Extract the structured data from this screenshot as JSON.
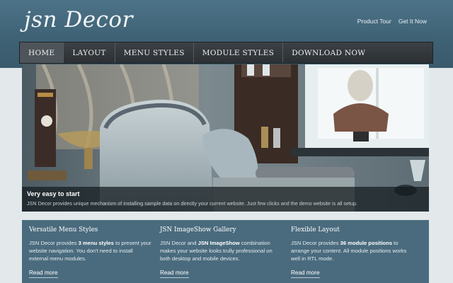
{
  "header": {
    "logo": "jsn Decor",
    "links": [
      "Product Tour",
      "Get It Now"
    ]
  },
  "nav": {
    "items": [
      "HOME",
      "LAYOUT",
      "MENU STYLES",
      "MODULE STYLES",
      "DOWNLOAD NOW"
    ],
    "active_index": 0
  },
  "hero": {
    "title": "Very easy to start",
    "text": "JSN Decor provides unique mechanism of installing sample data on directly your current website. Just few clicks and the demo website is all setup."
  },
  "features": [
    {
      "title": "Versatile Menu Styles",
      "body_before": "JSN Decor provides ",
      "body_bold": "3 menu styles",
      "body_after": " to present your website navigation. You don't need to install external menu modules.",
      "link": "Read more"
    },
    {
      "title": "JSN ImageShow Gallery",
      "body_before": "JSN Decor and ",
      "body_bold": "JSN ImageShow",
      "body_after": " combination makes your website looks trully professional on both desktop and mobile devices.",
      "link": "Read more"
    },
    {
      "title": "Flexible Layout",
      "body_before": "JSN Decor provides ",
      "body_bold": "36 module positions",
      "body_after": " to arrange your content. All module positions works well in RTL mode.",
      "link": "Read more"
    }
  ],
  "colors": {
    "header_bg": "#4d7389",
    "nav_bg": "#2f3438",
    "features_bg": "#4a6b7e",
    "page_bg": "#e3e8ea"
  }
}
